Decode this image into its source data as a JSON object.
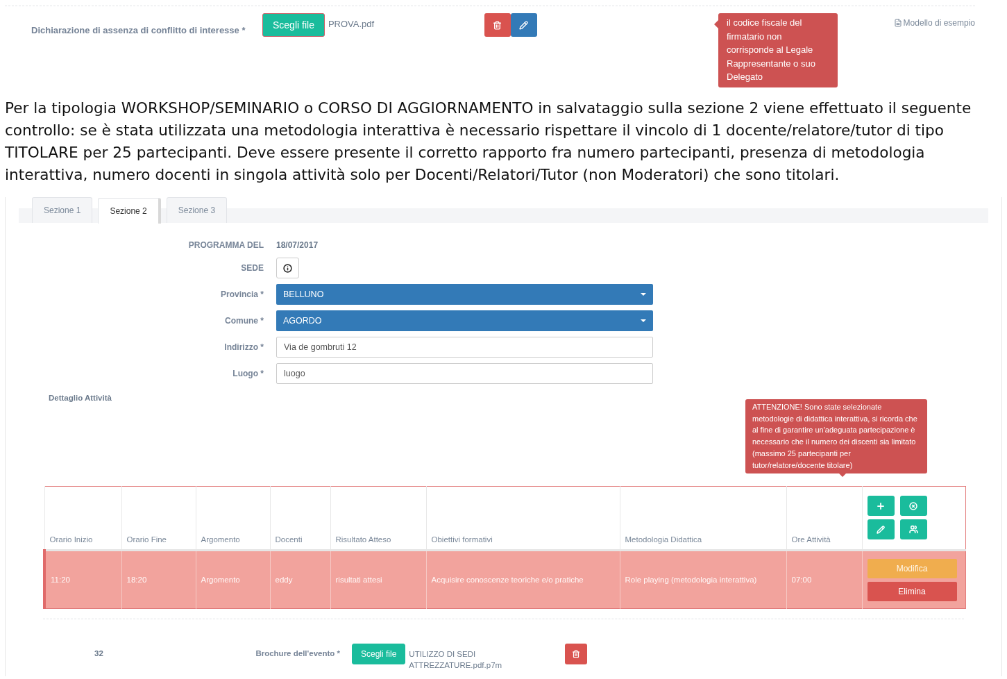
{
  "upload": {
    "label": "Dichiarazione di assenza di conflitto di interesse *",
    "button": "Scegli file",
    "filename": "PROVA.pdf",
    "error": "il codice fiscale del firmatario non corrisponde al Legale Rappresentante o suo Delegato",
    "example_link": "Modello di esempio"
  },
  "notice": "Per la tipologia WORKSHOP/SEMINARIO o CORSO DI AGGIORNAMENTO in salvataggio sulla sezione 2 viene effettuato il seguente controllo: se è stata utilizzata una metodologia interattiva è necessario rispettare il vincolo di 1 docente/relatore/tutor di tipo TITOLARE per 25 partecipanti. Deve essere presente il corretto rapporto fra numero partecipanti, presenza di metodologia interattiva, numero docenti in singola attività solo per Docenti/Relatori/Tutor (non Moderatori) che sono titolari.",
  "tabs": [
    {
      "label": "Sezione 1",
      "selected": false
    },
    {
      "label": "Sezione 2",
      "selected": true
    },
    {
      "label": "Sezione 3",
      "selected": false
    }
  ],
  "form": {
    "fields": [
      {
        "label": "PROGRAMMA DEL",
        "kind": "text",
        "value": "18/07/2017"
      },
      {
        "label": "SEDE",
        "kind": "info"
      },
      {
        "label": "Provincia *",
        "kind": "select",
        "value": "BELLUNO"
      },
      {
        "label": "Comune *",
        "kind": "select",
        "value": "AGORDO"
      },
      {
        "label": "Indirizzo *",
        "kind": "input",
        "value": "Via de gombruti 12"
      },
      {
        "label": "Luogo *",
        "kind": "input",
        "value": "luogo"
      }
    ]
  },
  "activities": {
    "title": "Dettaglio Attività",
    "warning": "ATTENZIONE! Sono state selezionate metodologie di didattica interattiva, si ricorda che al fine di garantire un'adeguata partecipazione è necessario che il numero dei discenti sia limitato (massimo 25 partecipanti per tutor/relatore/docente titolare)",
    "columns": [
      "Orario Inizio",
      "Orario Fine",
      "Argomento",
      "Docenti",
      "Risultato Atteso",
      "Obiettivi formativi",
      "Metodologia Didattica",
      "Ore Attività"
    ],
    "rows": [
      {
        "highlighted": true,
        "cells": [
          "11:20",
          "18:20",
          "Argomento",
          "eddy",
          "risultati attesi",
          "Acquisire conoscenze teoriche e/o pratiche",
          "Role playing (metodologia interattiva)",
          "07:00"
        ],
        "actions": [
          "Modifica",
          "Elimina"
        ]
      }
    ]
  },
  "brochure": {
    "number": "32",
    "label": "Brochure dell'evento *",
    "button": "Scegli file",
    "filename": "UTILIZZO DI SEDI ATTREZZATURE.pdf.p7m"
  }
}
